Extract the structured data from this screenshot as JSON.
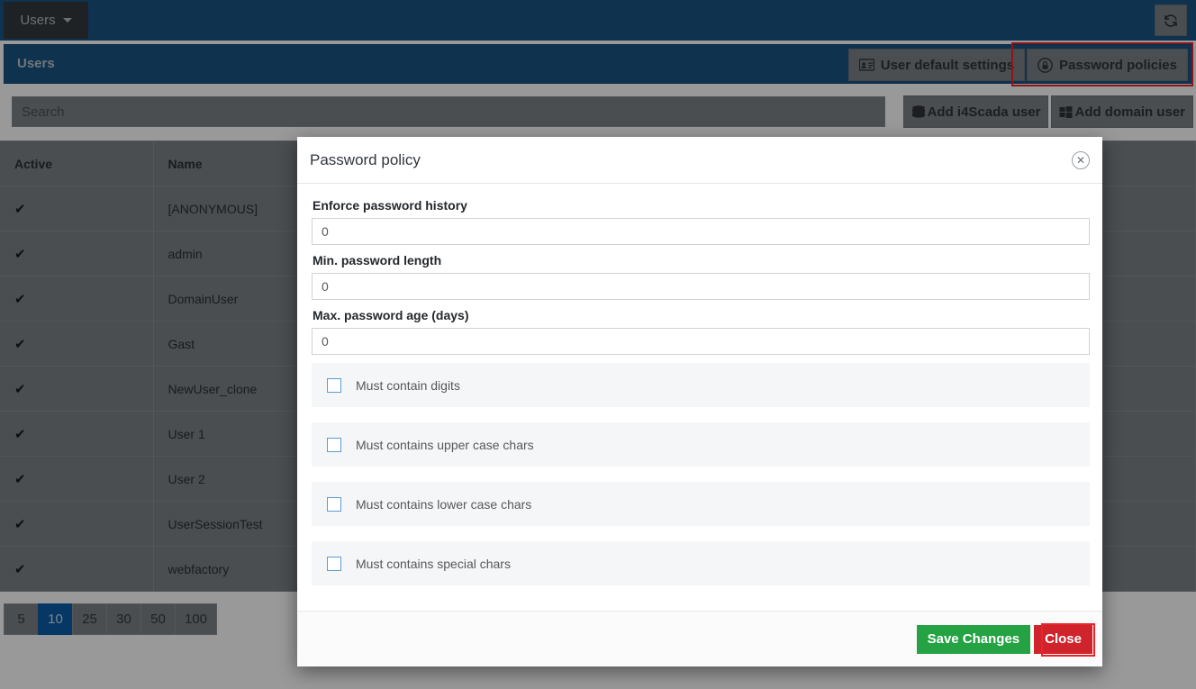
{
  "navbar": {
    "dropdown_label": "Users",
    "dropdown_icon": "chevron-down-icon",
    "refresh_icon": "refresh-icon",
    "refresh_glyph": "↻"
  },
  "section": {
    "title": "Users",
    "buttons": [
      {
        "label": "User default settings",
        "icon": "id-card-icon",
        "glyph": "Ὄ7",
        "highlighted": false
      },
      {
        "label": "Password policies",
        "icon": "lock-circle-icon",
        "glyph": "Ⓐ",
        "highlighted": true
      }
    ]
  },
  "toolbar": {
    "search_placeholder": "Search",
    "search_value": "",
    "add_buttons": [
      {
        "label": "Add i4Scada user",
        "icon": "database-icon"
      },
      {
        "label": "Add domain user",
        "icon": "windows-icon"
      }
    ]
  },
  "table": {
    "columns": [
      "Active",
      "Name",
      ""
    ],
    "check_glyph": "✔",
    "rows": [
      {
        "active": "✔",
        "name": "[ANONYMOUS]"
      },
      {
        "active": "✔",
        "name": "admin"
      },
      {
        "active": "✔",
        "name": "DomainUser"
      },
      {
        "active": "✔",
        "name": "Gast"
      },
      {
        "active": "✔",
        "name": "NewUser_clone"
      },
      {
        "active": "✔",
        "name": "User 1"
      },
      {
        "active": "✔",
        "name": "User 2"
      },
      {
        "active": "✔",
        "name": "UserSessionTest"
      },
      {
        "active": "✔",
        "name": "webfactory"
      }
    ]
  },
  "pagination": {
    "options": [
      "5",
      "10",
      "25",
      "30",
      "50",
      "100"
    ],
    "selected": "10"
  },
  "modal": {
    "title": "Password policy",
    "close_icon": "close-circle-icon",
    "close_glyph": "✕",
    "fields": [
      {
        "label": "Enforce password history",
        "value": "0"
      },
      {
        "label": "Min. password length",
        "value": "0"
      },
      {
        "label": "Max. password age (days)",
        "value": "0"
      }
    ],
    "checkboxes": [
      {
        "label": "Must contain digits",
        "checked": false
      },
      {
        "label": "Must contains upper case chars",
        "checked": false
      },
      {
        "label": "Must contains lower case chars",
        "checked": false
      },
      {
        "label": "Must contains special chars",
        "checked": false
      }
    ],
    "save_label": "Save Changes",
    "close_label": "Close"
  },
  "colors": {
    "brand_blue": "#1a5484",
    "navbar_dark": "#35393d",
    "accent_blue": "#0b5da8",
    "highlight_red": "#e8252a",
    "save_green": "#25a244",
    "close_red": "#d0242c"
  }
}
